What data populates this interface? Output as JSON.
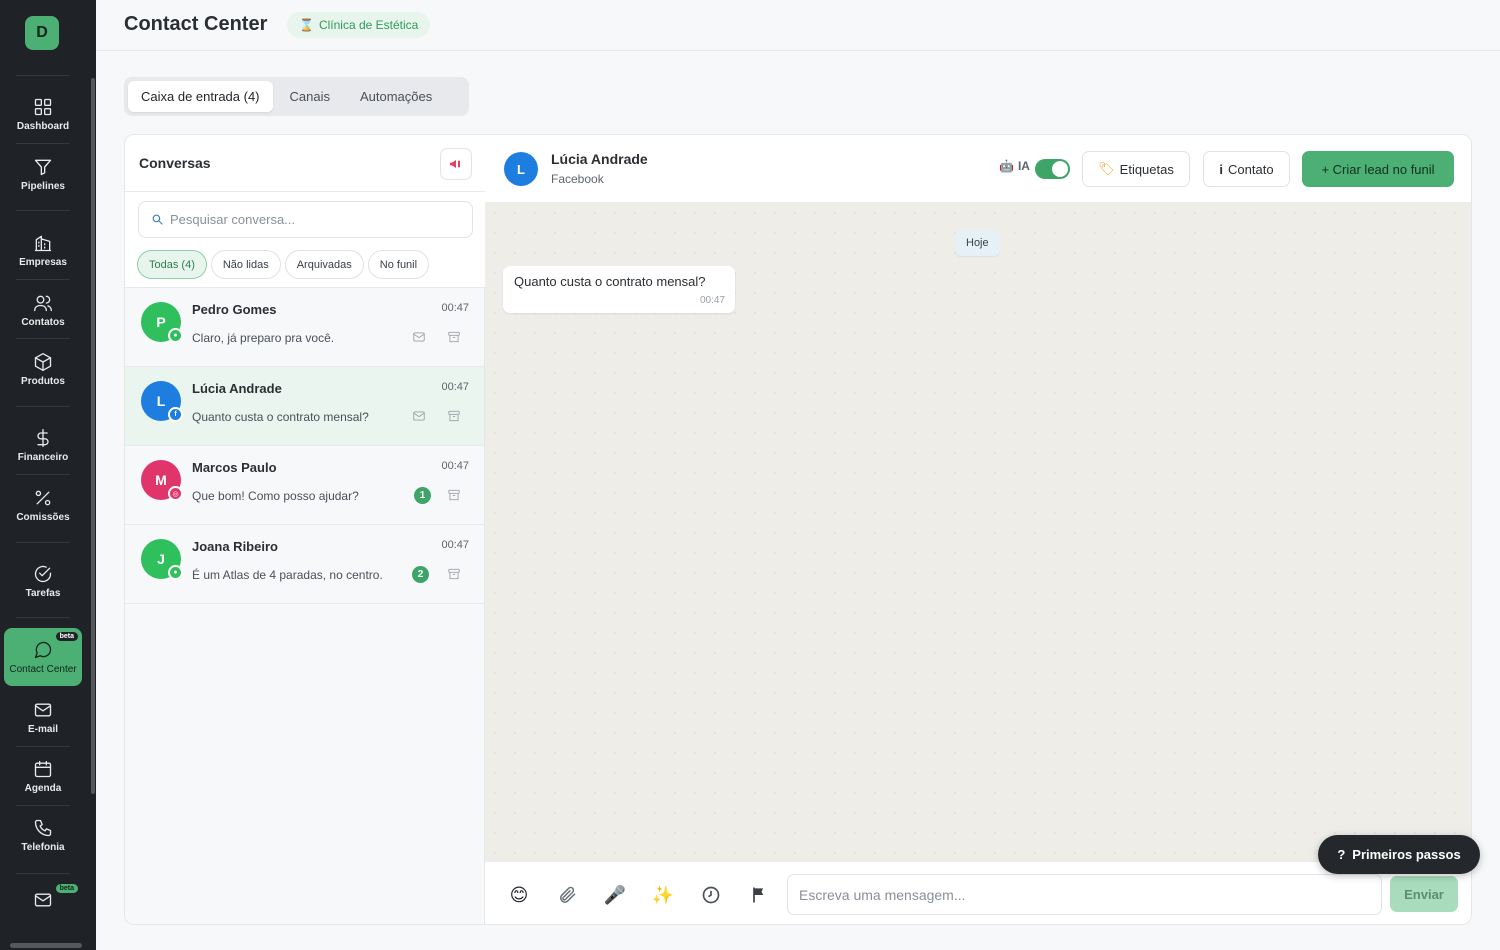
{
  "app": {
    "logo_letter": "D",
    "page_title": "Contact Center",
    "org_badge": "Clínica de Estética",
    "accent_color": "#4caf74"
  },
  "sidebar": {
    "items": [
      {
        "label": "Dashboard",
        "icon": "dashboard-grid-icon"
      },
      {
        "label": "Pipelines",
        "icon": "funnel-icon"
      },
      {
        "label": "Empresas",
        "icon": "building-icon"
      },
      {
        "label": "Contatos",
        "icon": "users-icon"
      },
      {
        "label": "Produtos",
        "icon": "box-icon"
      },
      {
        "label": "Financeiro",
        "icon": "dollar-icon"
      },
      {
        "label": "Comissões",
        "icon": "percent-icon"
      },
      {
        "label": "Tarefas",
        "icon": "check-circle-icon"
      },
      {
        "label": "Contact Center",
        "icon": "chat-bubble-icon",
        "badge": "beta",
        "active": true
      },
      {
        "label": "E-mail",
        "icon": "mail-icon"
      },
      {
        "label": "Agenda",
        "icon": "calendar-icon"
      },
      {
        "label": "Telefonia",
        "icon": "phone-icon"
      },
      {
        "label": "",
        "icon": "mail-icon",
        "badge": "beta"
      }
    ]
  },
  "tabs": [
    {
      "label": "Caixa de entrada (4)",
      "active": true
    },
    {
      "label": "Canais"
    },
    {
      "label": "Automações"
    }
  ],
  "conversations": {
    "title": "Conversas",
    "search_placeholder": "Pesquisar conversa...",
    "filters": [
      {
        "label": "Todas (4)",
        "active": true
      },
      {
        "label": "Não lidas"
      },
      {
        "label": "Arquivadas"
      },
      {
        "label": "No funil"
      }
    ],
    "items": [
      {
        "initial": "P",
        "name": "Pedro Gomes",
        "time": "00:47",
        "preview": "Claro, já preparo pra você.",
        "avatar_color": "#2fbf5c",
        "channel": "whatsapp",
        "channel_color": "#2fbf5c",
        "unread": null
      },
      {
        "initial": "L",
        "name": "Lúcia Andrade",
        "time": "00:47",
        "preview": "Quanto custa o contrato mensal?",
        "avatar_color": "#1e7ee0",
        "channel": "facebook",
        "channel_color": "#1e7ee0",
        "unread": null,
        "selected": true
      },
      {
        "initial": "M",
        "name": "Marcos Paulo",
        "time": "00:47",
        "preview": "Que bom! Como posso ajudar?",
        "avatar_color": "#e0356a",
        "channel": "instagram",
        "channel_color": "#e0356a",
        "unread": "1"
      },
      {
        "initial": "J",
        "name": "Joana Ribeiro",
        "time": "00:47",
        "preview": "É um Atlas de 4 paradas, no centro.",
        "avatar_color": "#2fbf5c",
        "channel": "whatsapp",
        "channel_color": "#2fbf5c",
        "unread": "2"
      }
    ]
  },
  "chat": {
    "contact_initial": "L",
    "contact_name": "Lúcia Andrade",
    "contact_channel": "Facebook",
    "ia_label": "IA",
    "ia_enabled": true,
    "tags_button": "Etiquetas",
    "contact_button": "Contato",
    "create_lead_button": "+ Criar lead no funil",
    "day_label": "Hoje",
    "messages": [
      {
        "text": "Quanto custa o contrato mensal?",
        "time": "00:47",
        "direction": "incoming"
      }
    ],
    "composer_placeholder": "Escreva uma mensagem...",
    "send_label": "Enviar",
    "tools": [
      "emoji-icon",
      "paperclip-icon",
      "microphone-icon",
      "sparkles-icon",
      "clock-icon",
      "flag-icon"
    ]
  },
  "help": {
    "label": "Primeiros passos"
  }
}
